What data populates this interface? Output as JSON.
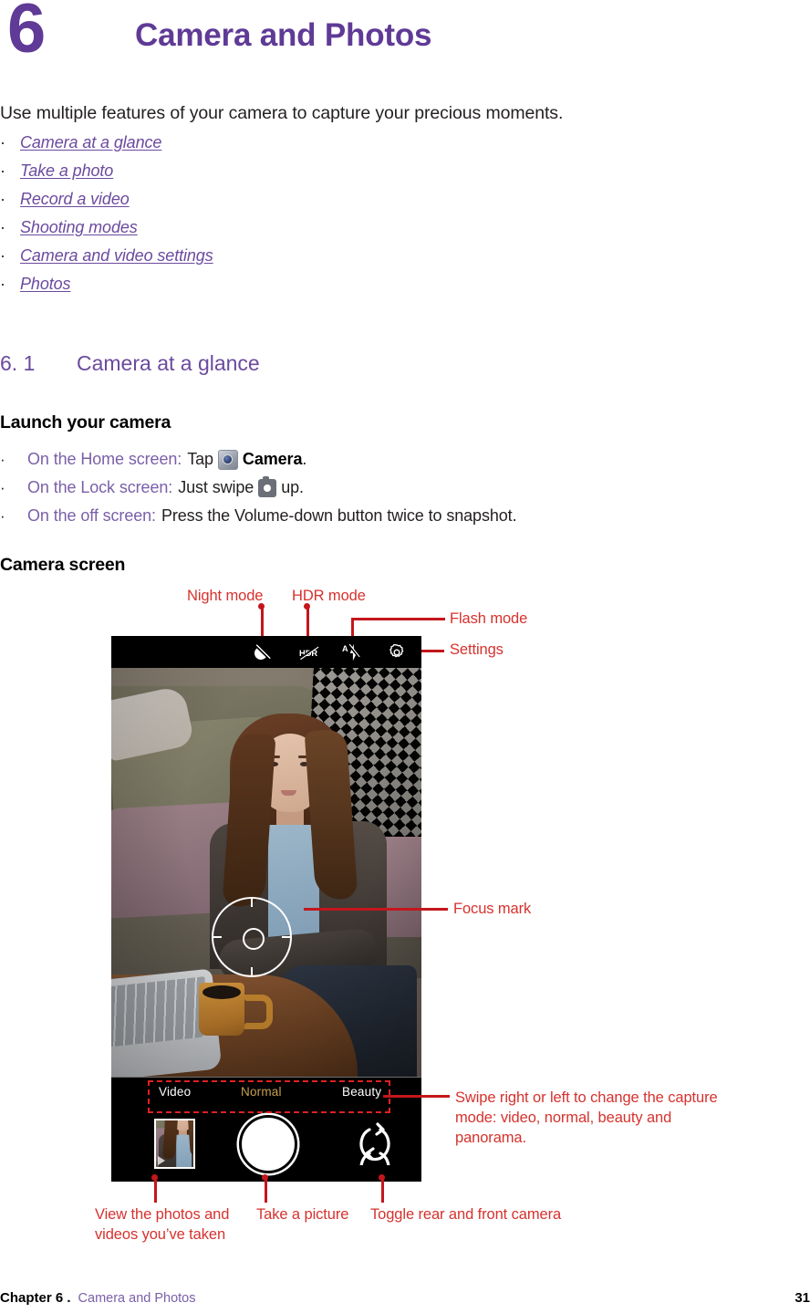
{
  "chapter": {
    "number": "6",
    "title": "Camera and Photos"
  },
  "intro": "Use multiple features of your camera to capture your precious moments.",
  "toc": {
    "bullet": "·",
    "items": [
      {
        "label": "Camera at a glance"
      },
      {
        "label": "Take a photo"
      },
      {
        "label": "Record a video"
      },
      {
        "label": "Shooting modes"
      },
      {
        "label": "Camera and video settings"
      },
      {
        "label": "Photos"
      }
    ]
  },
  "section": {
    "number": "6. 1",
    "title": "Camera at a glance",
    "launch_heading": "Launch your camera",
    "camera_screen_heading": "Camera screen"
  },
  "launch_items": [
    {
      "bullet": "·",
      "lead": "On the Home screen:",
      "text_before_icon": "Tap",
      "icon": "camera-app-icon",
      "bold_text": "Camera",
      "text_after": "."
    },
    {
      "bullet": "·",
      "lead": "On the Lock screen:",
      "text_before_icon": "Just swipe",
      "icon": "camera-lock-icon",
      "bold_text": "",
      "text_after": "up."
    },
    {
      "bullet": "·",
      "lead": "On the off screen:",
      "text_before_icon": "Press the Volume-down button twice to snapshot.",
      "icon": "",
      "bold_text": "",
      "text_after": ""
    }
  ],
  "camera_ui": {
    "toolbar": [
      {
        "name": "night-mode-icon",
        "label": "Night mode"
      },
      {
        "name": "hdr-mode-icon",
        "label": "HDR mode"
      },
      {
        "name": "flash-mode-icon",
        "label": "Flash mode"
      },
      {
        "name": "settings-gear-icon",
        "label": "Settings"
      }
    ],
    "modes": [
      {
        "label": "Video",
        "active": false
      },
      {
        "label": "Normal",
        "active": true
      },
      {
        "label": "Beauty",
        "active": false
      }
    ],
    "focus_mark_label": "Focus mark",
    "shutter_label": "Take a picture",
    "thumbnail_label": "View the photos and videos you’ve taken",
    "toggle_label": "Toggle rear and front camera",
    "swipe_label": "Swipe right or left to change the capture mode: video, normal, beauty and panorama."
  },
  "annotations": {
    "night_mode": "Night mode",
    "hdr_mode": "HDR mode",
    "flash_mode": "Flash mode",
    "settings": "Settings",
    "focus_mark": "Focus mark",
    "swipe": "Swipe right or left to change the capture mode: video, normal, beauty and panorama.",
    "view_photos": "View the photos and videos you’ve taken",
    "take_picture": "Take a picture",
    "toggle_camera": "Toggle rear and front camera"
  },
  "footer": {
    "chapter_label": "Chapter 6 .",
    "chapter_name": "Camera and Photos",
    "page": "31"
  },
  "colors": {
    "purple": "#5f3a96",
    "link_purple": "#6b4a9e",
    "annotation_red": "#d6322e",
    "mode_active": "#c8a04e"
  }
}
